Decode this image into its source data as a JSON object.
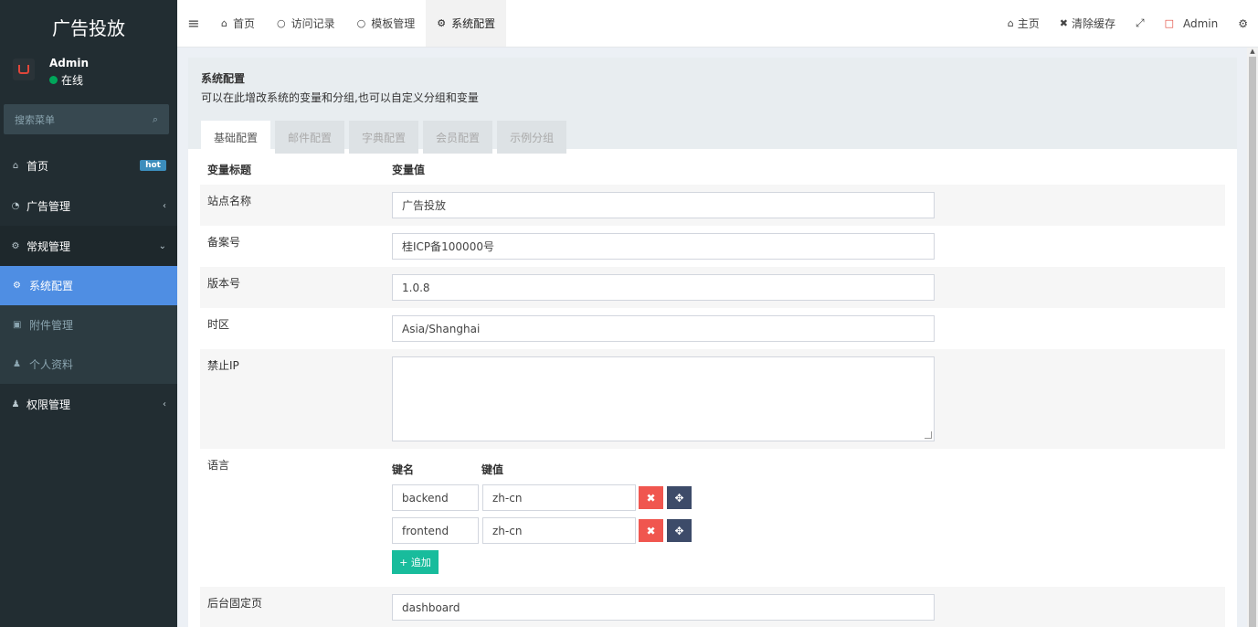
{
  "sidebar": {
    "logo": "广告投放",
    "user": {
      "name": "Admin",
      "status": "在线"
    },
    "search_placeholder": "搜索菜单",
    "menu": [
      {
        "label": "首页",
        "icon": "home-icon",
        "badge": "hot"
      },
      {
        "label": "广告管理",
        "icon": "ads-icon",
        "chevron": "‹"
      },
      {
        "label": "常规管理",
        "icon": "cogs-icon",
        "chevron": "⌄"
      }
    ],
    "submenu": [
      {
        "label": "系统配置",
        "icon": "gear-icon",
        "active": true
      },
      {
        "label": "附件管理",
        "icon": "image-icon"
      },
      {
        "label": "个人资料",
        "icon": "user-icon"
      }
    ],
    "menu_after": {
      "label": "权限管理",
      "icon": "users-icon",
      "chevron": "‹"
    }
  },
  "topbar": {
    "tabs": [
      {
        "label": "首页",
        "icon": "home-icon"
      },
      {
        "label": "访问记录",
        "icon": "circle-icon"
      },
      {
        "label": "模板管理",
        "icon": "circle-icon"
      },
      {
        "label": "系统配置",
        "icon": "gear-icon",
        "active": true
      }
    ],
    "right": {
      "home": "主页",
      "clear_cache": "清除缓存",
      "admin": "Admin"
    }
  },
  "panel": {
    "title": "系统配置",
    "description": "可以在此增改系统的变量和分组,也可以自定义分组和变量",
    "tabs": [
      "基础配置",
      "邮件配置",
      "字典配置",
      "会员配置",
      "示例分组"
    ]
  },
  "table": {
    "col_title": "变量标题",
    "col_value": "变量值",
    "rows": {
      "site_name": {
        "label": "站点名称",
        "value": "广告投放"
      },
      "beian": {
        "label": "备案号",
        "value": "桂ICP备100000号"
      },
      "version": {
        "label": "版本号",
        "value": "1.0.8"
      },
      "timezone": {
        "label": "时区",
        "value": "Asia/Shanghai"
      },
      "forbidden_ip": {
        "label": "禁止IP",
        "value": ""
      },
      "language": {
        "label": "语言",
        "key_header": "键名",
        "value_header": "键值",
        "pairs": [
          {
            "key": "backend",
            "value": "zh-cn"
          },
          {
            "key": "frontend",
            "value": "zh-cn"
          }
        ],
        "add_label": "+ 追加",
        "delete_glyph": "✖",
        "move_glyph": "✥"
      },
      "fixed_page": {
        "label": "后台固定页",
        "value": "dashboard"
      }
    }
  }
}
